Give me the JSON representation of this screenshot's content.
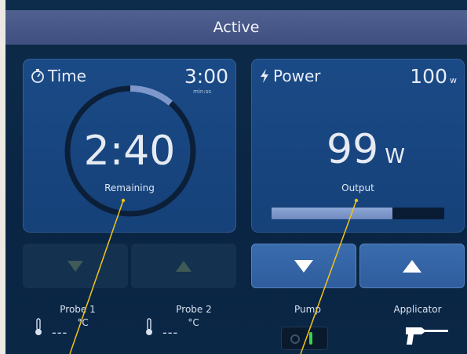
{
  "header": {
    "title": "Active"
  },
  "time_panel": {
    "title": "Time",
    "setting": "3:00",
    "setting_sub": "min:ss",
    "value": "2:40",
    "caption": "Remaining",
    "elapsed_fraction": 0.111
  },
  "power_panel": {
    "title": "Power",
    "setting": "100",
    "setting_unit": "w",
    "value": "99",
    "value_unit": "W",
    "caption": "Output",
    "output_fraction": 0.7
  },
  "controls": {
    "time_down": "▼",
    "time_up": "▲",
    "power_down": "▼",
    "power_up": "▲"
  },
  "status": {
    "probe1": {
      "label": "Probe 1",
      "value": "---",
      "unit": "°C"
    },
    "probe2": {
      "label": "Probe 2",
      "value": "---",
      "unit": "°C"
    },
    "pump": {
      "label": "Pump",
      "state": "on"
    },
    "applicator": {
      "label": "Applicator"
    }
  },
  "colors": {
    "accent_bar": "#7f98cc",
    "pump_on": "#3bd24a",
    "panel": "#1a4a86"
  },
  "icons": [
    "stopwatch-icon",
    "lightning-icon",
    "thermometer-icon",
    "applicator-icon"
  ]
}
